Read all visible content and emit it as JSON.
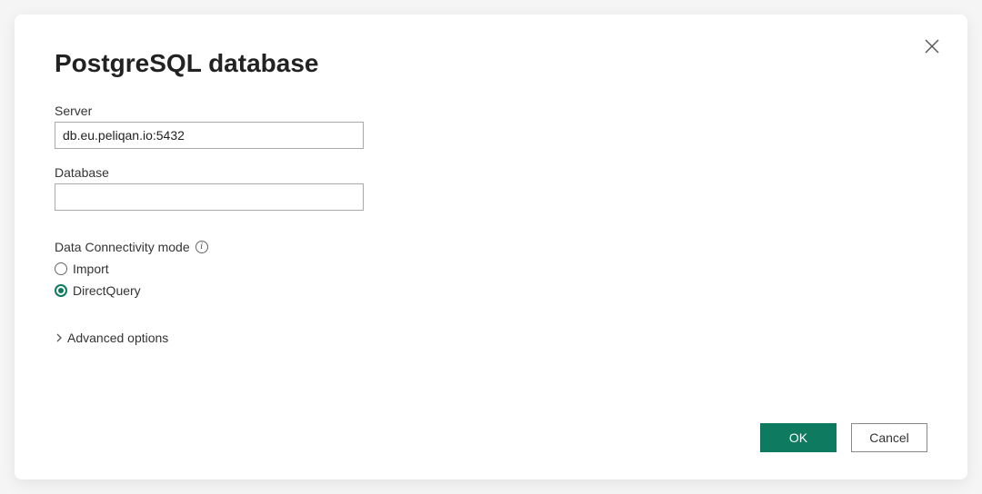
{
  "dialog": {
    "title": "PostgreSQL database"
  },
  "fields": {
    "server": {
      "label": "Server",
      "value": "db.eu.peliqan.io:5432"
    },
    "database": {
      "label": "Database",
      "value": ""
    }
  },
  "connectivity": {
    "label": "Data Connectivity mode",
    "options": {
      "import": "Import",
      "directquery": "DirectQuery"
    },
    "selected": "directquery"
  },
  "accordion": {
    "advanced": "Advanced options"
  },
  "buttons": {
    "ok": "OK",
    "cancel": "Cancel"
  }
}
